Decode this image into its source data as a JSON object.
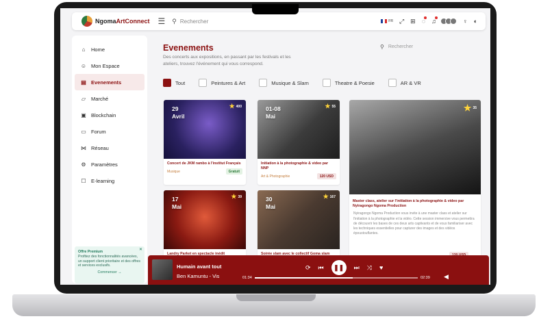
{
  "app": {
    "brand_a": "Ngoma",
    "brand_b": "ArtConnect"
  },
  "topbar": {
    "search_placeholder": "Rechercher",
    "lang": "FR"
  },
  "sidebar": {
    "items": [
      {
        "label": "Home",
        "icon": "home-icon"
      },
      {
        "label": "Mon Espace",
        "icon": "user-icon"
      },
      {
        "label": "Evenements",
        "icon": "calendar-icon",
        "active": true
      },
      {
        "label": "Marché",
        "icon": "cart-icon"
      },
      {
        "label": "Blockchain",
        "icon": "blockchain-icon"
      },
      {
        "label": "Forum",
        "icon": "forum-icon"
      },
      {
        "label": "Réseau",
        "icon": "network-icon"
      },
      {
        "label": "Paramètres",
        "icon": "gear-icon"
      },
      {
        "label": "E-learning",
        "icon": "learning-icon"
      }
    ],
    "promo": {
      "title": "Offre Premium",
      "text": "Profitez des fonctionnalités avancées, un support client prioritaire et des offres et services exclusifs.",
      "link": "Commencer →"
    }
  },
  "main": {
    "title": "Evenements",
    "subtitle": "Des concerts aux expositions, en passant par les festivals et les ateliers, trouvez l'événement qui vous correspond.",
    "search_placeholder": "Rechercher",
    "filters": [
      {
        "label": "Tout",
        "checked": true
      },
      {
        "label": "Peintures & Art",
        "checked": false
      },
      {
        "label": "Musique & Slam",
        "checked": false
      },
      {
        "label": "Theatre & Poesie",
        "checked": false
      },
      {
        "label": "AR & VR",
        "checked": false
      }
    ],
    "cards": [
      {
        "day": "29",
        "month": "Avril",
        "rating": "400",
        "title": "Concert de JKM rambo à l'institut Français",
        "category": "Musique",
        "price": "Gratuit"
      },
      {
        "day": "01-08",
        "month": "Mai",
        "rating": "55",
        "title": "Initiation à la photographie & video par NNP",
        "category": "Art & Photographie",
        "price": "120 USD"
      },
      {
        "rating": "35",
        "title": "Master class, atelier sur l'initiation à la photographie & video par Nyiragongo Ngoma Production",
        "description": "Nyiragongo Ngoma Production vous invite à une master class et atelier sur l'initiation à la photographie et la vidéo. Cette session immersive vous permettra de découvrir les bases de ces deux arts captivants et de vous familiariser avec les techniques essentielles pour capturer des images et des vidéos époustouflantes.",
        "price": "120 USD"
      },
      {
        "day": "17",
        "month": "Mai",
        "rating": "39",
        "title": "Landry Parket en spectacle inédit"
      },
      {
        "day": "30",
        "month": "Mai",
        "rating": "167",
        "title": "Soirée slam avec le collectif Goma slam"
      }
    ]
  },
  "player": {
    "title": "Humain avant tout",
    "artist": "Ben Kamuntu - Vis",
    "current": "01:34",
    "total": "02:39",
    "progress": 0.6
  },
  "colors": {
    "accent": "#8b1111",
    "player_bg": "#8b1010"
  }
}
